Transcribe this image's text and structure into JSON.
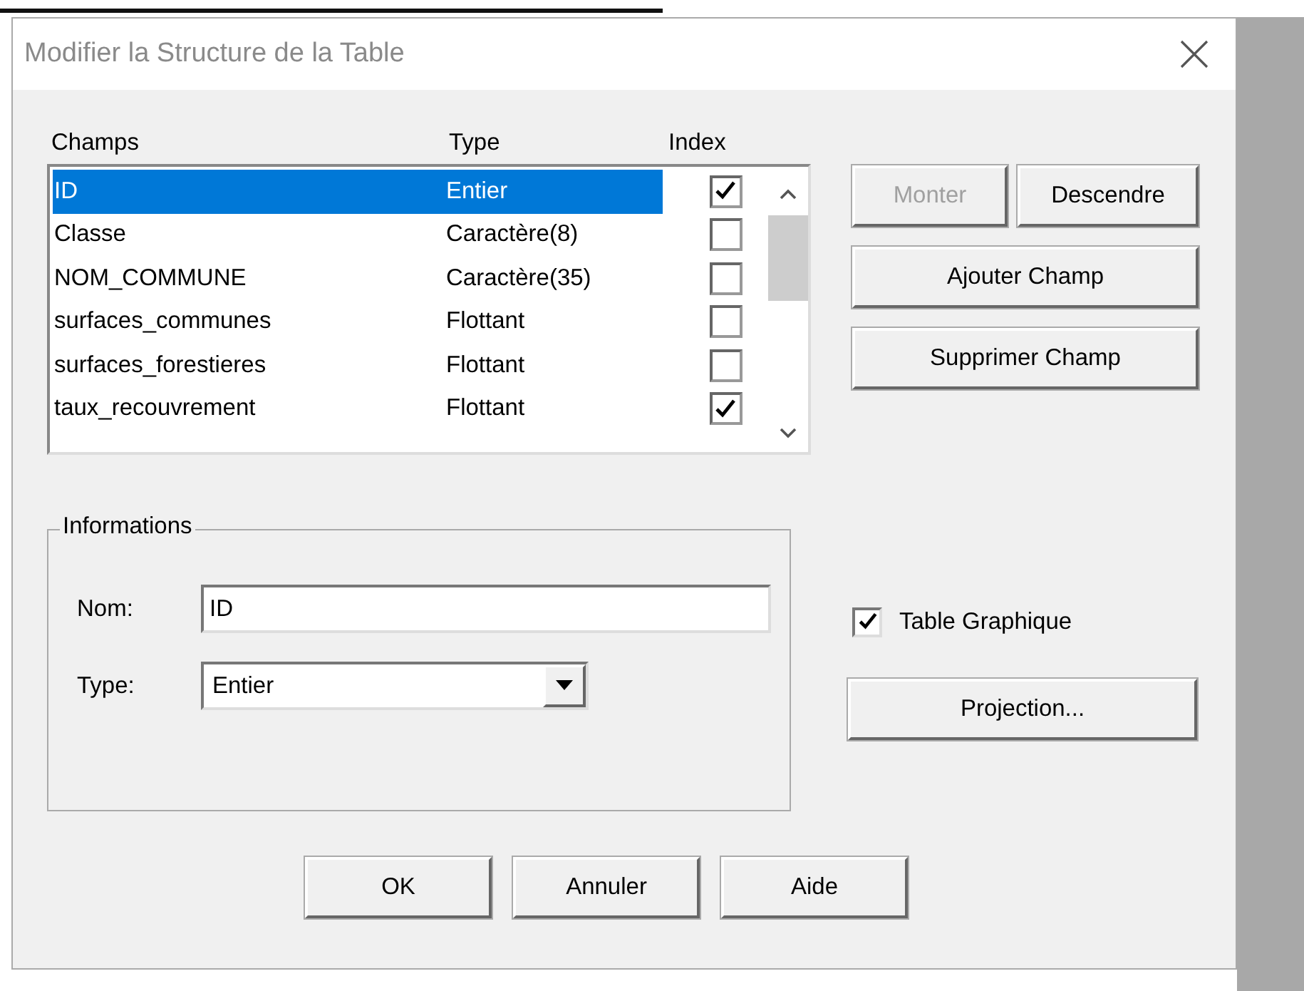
{
  "window": {
    "title": "Modifier la Structure de la Table"
  },
  "fields": {
    "columns": [
      "Champs",
      "Type",
      "Index"
    ],
    "rows": [
      {
        "name": "ID",
        "type": "Entier",
        "index": true,
        "selected": true
      },
      {
        "name": "Classe",
        "type": "Caractère(8)",
        "index": false,
        "selected": false
      },
      {
        "name": "NOM_COMMUNE",
        "type": "Caractère(35)",
        "index": false,
        "selected": false
      },
      {
        "name": "surfaces_communes",
        "type": "Flottant",
        "index": false,
        "selected": false
      },
      {
        "name": "surfaces_forestieres",
        "type": "Flottant",
        "index": false,
        "selected": false
      },
      {
        "name": "taux_recouvrement",
        "type": "Flottant",
        "index": true,
        "selected": false
      }
    ]
  },
  "buttons": [
    {
      "label": "Monter",
      "disabled": true
    },
    {
      "label": "Descendre",
      "disabled": false
    },
    {
      "label": "Ajouter Champ",
      "disabled": false
    },
    {
      "label": "Supprimer Champ",
      "disabled": false
    }
  ],
  "informations": {
    "title": "Informations",
    "name_label": "Nom:",
    "name_value": "ID",
    "type_label": "Type:",
    "type_value": "Entier"
  },
  "graphic_table": {
    "label": "Table Graphique",
    "checked": true
  },
  "projection_button": "Projection...",
  "footer_buttons": [
    "OK",
    "Annuler",
    "Aide"
  ]
}
